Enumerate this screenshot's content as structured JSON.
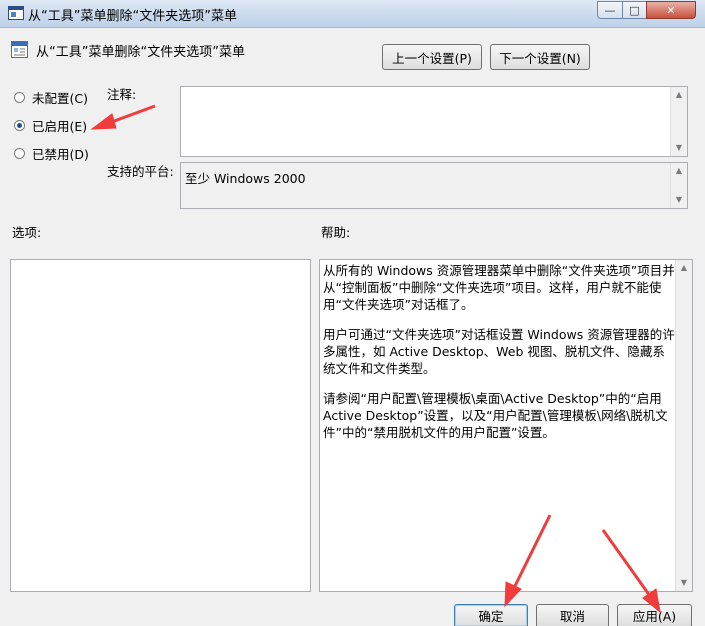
{
  "window": {
    "title": "从“工具”菜单删除“文件夹选项”菜单",
    "minimize_glyph": "—",
    "maximize_glyph": "□",
    "close_glyph": "✕"
  },
  "header": {
    "title": "从“工具”菜单删除“文件夹选项”菜单",
    "prev_button": "上一个设置(P)",
    "next_button": "下一个设置(N)"
  },
  "radios": [
    {
      "label": "未配置(C)",
      "checked": false
    },
    {
      "label": "已启用(E)",
      "checked": true
    },
    {
      "label": "已禁用(D)",
      "checked": false
    }
  ],
  "comment": {
    "label": "注释:",
    "value": ""
  },
  "platform": {
    "label": "支持的平台:",
    "value": "至少 Windows 2000"
  },
  "options": {
    "label": "选项:"
  },
  "help": {
    "label": "帮助:",
    "paragraphs": [
      "从所有的 Windows 资源管理器菜单中删除“文件夹选项”项目并从“控制面板”中删除“文件夹选项”项目。这样，用户就不能使用“文件夹选项”对话框了。",
      "用户可通过“文件夹选项”对话框设置 Windows 资源管理器的许多属性，如 Active Desktop、Web 视图、脱机文件、隐藏系统文件和文件类型。",
      "请参阅“用户配置\\管理模板\\桌面\\Active Desktop”中的“启用 Active Desktop”设置，以及“用户配置\\管理模板\\网络\\脱机文件”中的“禁用脱机文件的用户配置”设置。"
    ]
  },
  "footer": {
    "ok": "确定",
    "cancel": "取消",
    "apply": "应用(A)"
  },
  "colors": {
    "annotation_arrow": "#f03c3c",
    "radio_dot": "#1f4f8c"
  }
}
